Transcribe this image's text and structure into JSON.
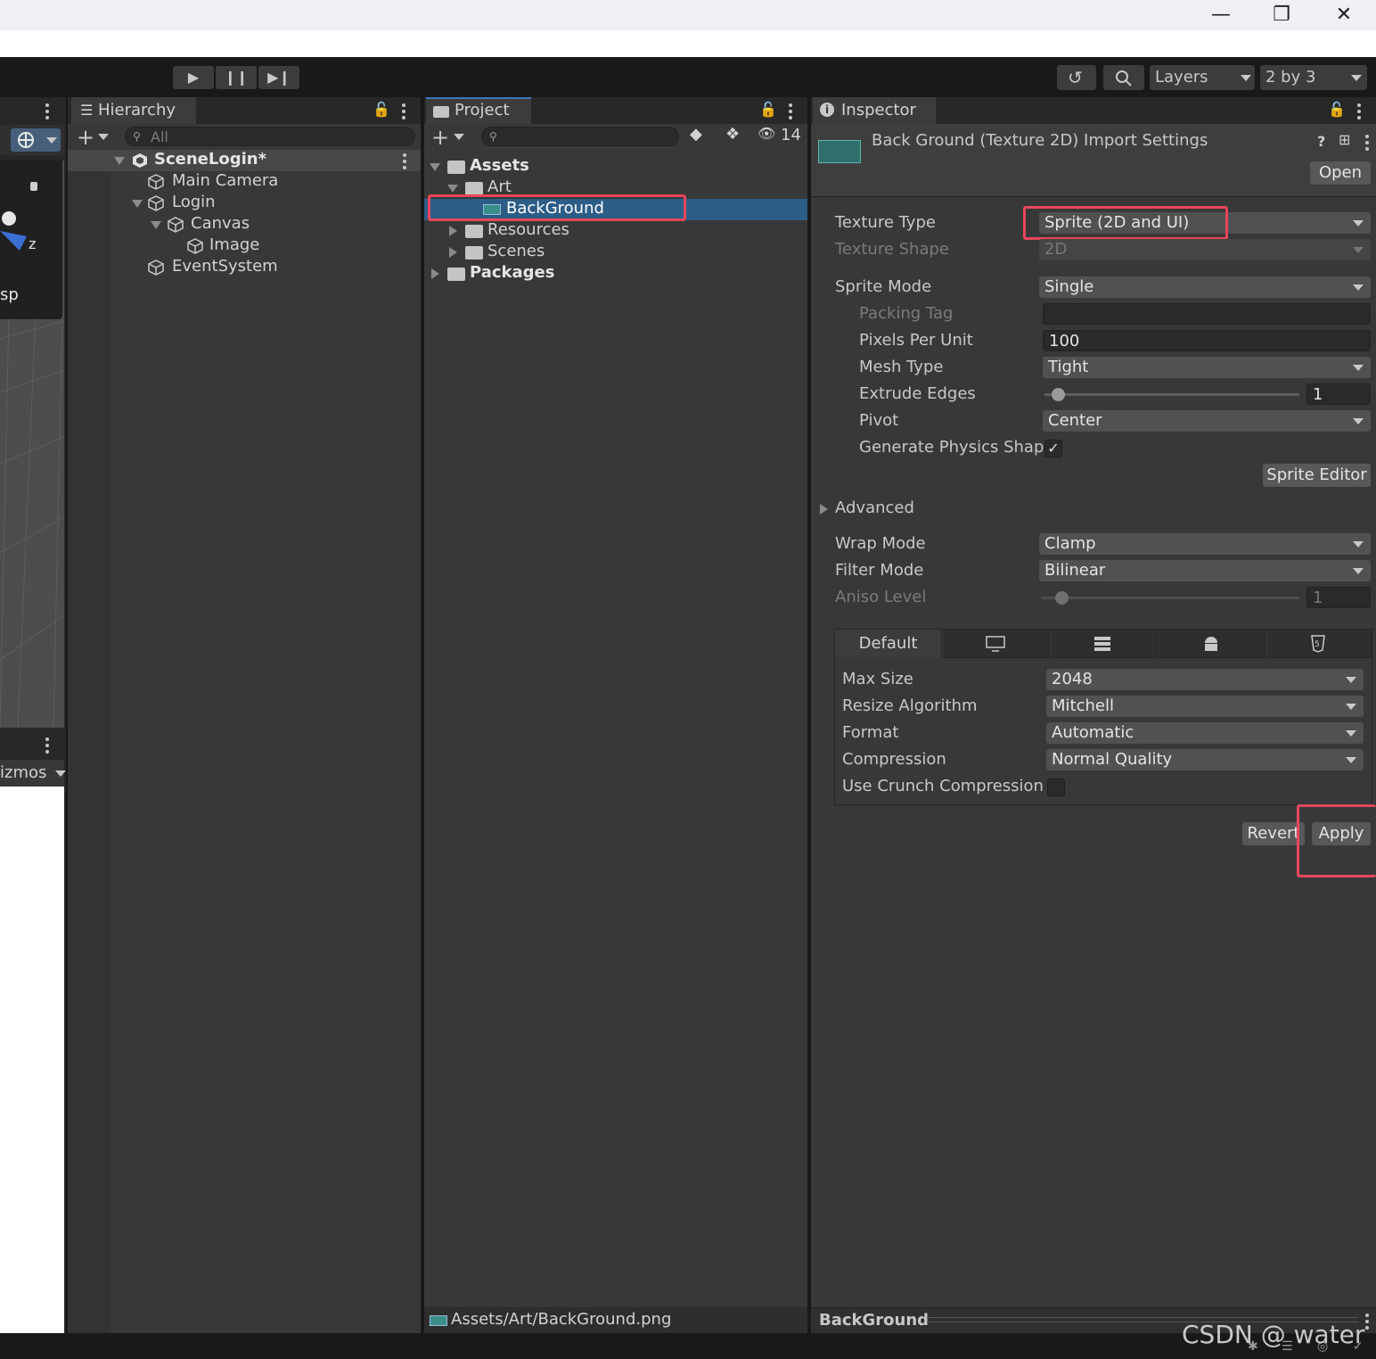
{
  "toolbar": {
    "layers_label": "Layers",
    "layout_label": "2 by 3"
  },
  "scene_view": {
    "persp_label": "sp",
    "axis_label": "z",
    "gizmos_label": "izmos"
  },
  "hierarchy": {
    "tab_label": "Hierarchy",
    "search_placeholder": "All",
    "scene_name": "SceneLogin*",
    "items": [
      "Main Camera",
      "Login",
      "Canvas",
      "Image",
      "EventSystem"
    ]
  },
  "project": {
    "tab_label": "Project",
    "hidden_count": "14",
    "tree": {
      "assets": "Assets",
      "art": "Art",
      "background": "BackGround",
      "resources": "Resources",
      "scenes": "Scenes",
      "packages": "Packages"
    },
    "status_path": "Assets/Art/BackGround.png"
  },
  "inspector": {
    "tab_label": "Inspector",
    "header_title": "Back Ground (Texture 2D) Import Settings",
    "open_label": "Open",
    "fields": {
      "texture_type_label": "Texture Type",
      "texture_type_value": "Sprite (2D and UI)",
      "texture_shape_label": "Texture Shape",
      "texture_shape_value": "2D",
      "sprite_mode_label": "Sprite Mode",
      "sprite_mode_value": "Single",
      "packing_tag_label": "Packing Tag",
      "packing_tag_value": "",
      "ppu_label": "Pixels Per Unit",
      "ppu_value": "100",
      "mesh_type_label": "Mesh Type",
      "mesh_type_value": "Tight",
      "extrude_label": "Extrude Edges",
      "extrude_value": "1",
      "pivot_label": "Pivot",
      "pivot_value": "Center",
      "physics_label": "Generate Physics Shap",
      "physics_checked": true,
      "sprite_editor_label": "Sprite Editor",
      "advanced_label": "Advanced",
      "wrap_label": "Wrap Mode",
      "wrap_value": "Clamp",
      "filter_label": "Filter Mode",
      "filter_value": "Bilinear",
      "aniso_label": "Aniso Level",
      "aniso_value": "1"
    },
    "platform": {
      "default_tab": "Default",
      "max_size_label": "Max Size",
      "max_size_value": "2048",
      "resize_label": "Resize Algorithm",
      "resize_value": "Mitchell",
      "format_label": "Format",
      "format_value": "Automatic",
      "compression_label": "Compression",
      "compression_value": "Normal Quality",
      "crunch_label": "Use Crunch Compression",
      "crunch_checked": false
    },
    "revert_label": "Revert",
    "apply_label": "Apply",
    "footer_label": "BackGround"
  },
  "watermark": "CSDN @ water",
  "colors": {
    "highlight_red": "#e8465b",
    "selection_blue": "#2c5d87",
    "panel_bg": "#383838"
  }
}
